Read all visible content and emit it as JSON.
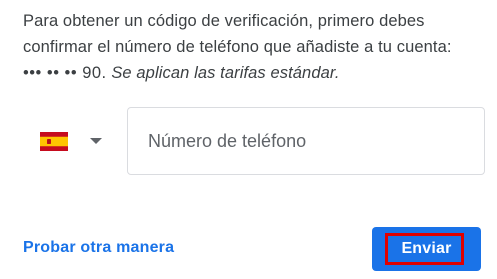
{
  "instructions": {
    "line1": "Para obtener un código de verificación, primero debes",
    "line2": "confirmar el número de teléfono que añadiste a tu cuenta:",
    "masked_number": "••• •• •• 90.",
    "note": "Se aplican las tarifas estándar."
  },
  "country": {
    "flag_icon": "spain-flag-icon",
    "flag_colors": {
      "red": "#c60b1e",
      "yellow": "#ffc400"
    },
    "arrow_icon": "chevron-down-icon"
  },
  "phone": {
    "placeholder": "Número de teléfono",
    "value": ""
  },
  "actions": {
    "alt_link": "Probar otra manera",
    "send_label": "Enviar"
  },
  "colors": {
    "accent": "#1a73e8",
    "highlight": "#e00000",
    "border": "#dadce0"
  }
}
